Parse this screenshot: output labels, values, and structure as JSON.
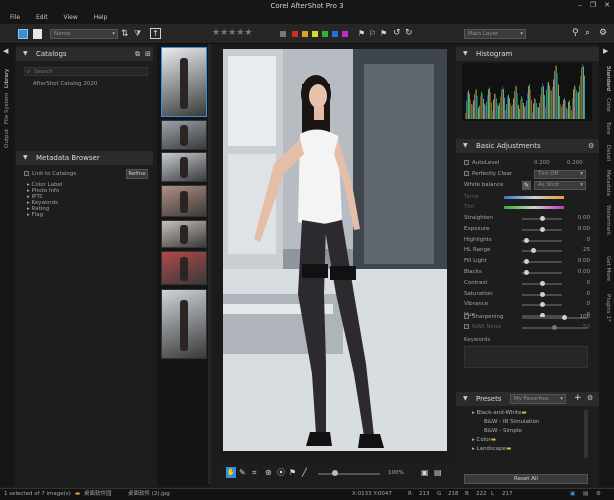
{
  "app": {
    "title": "Corel AfterShot Pro 3"
  },
  "menu": [
    "File",
    "Edit",
    "View",
    "Help"
  ],
  "window_controls": [
    "–",
    "❐",
    "✕"
  ],
  "toolbar": {
    "name_dropdown": "Name",
    "layer_dropdown": "Main Layer",
    "color_labels": [
      "#d12b2b",
      "#e0a020",
      "#d8d82a",
      "#2fb52f",
      "#2b6bd8",
      "#c22ac2"
    ]
  },
  "left_tabs": [
    "Library",
    "File System",
    "Output"
  ],
  "catalogs": {
    "title": "Catalogs",
    "search_placeholder": "Search",
    "items": [
      "AfterShot Catalog 2020"
    ]
  },
  "metadata": {
    "title": "Metadata Browser",
    "link_label": "Link to Catalogs",
    "refine_label": "Refine",
    "items": [
      "Color Label",
      "Photo Info",
      "IPTC",
      "Keywords",
      "Rating",
      "Flag"
    ]
  },
  "viewer": {
    "zoom": "100%"
  },
  "histogram": {
    "title": "Histogram"
  },
  "basic": {
    "title": "Basic Adjustments",
    "autolevel": {
      "label": "AutoLevel",
      "v1": "0.200",
      "v2": "0.200"
    },
    "perfectly_clear": {
      "label": "Perfectly Clear",
      "value": "Tint Off"
    },
    "white_balance": {
      "label": "White balance",
      "value": "As Shot"
    },
    "temp_label": "Temp",
    "tint_label": "Tint",
    "sliders": [
      {
        "label": "Straighten",
        "value": "0.00",
        "pos": 0.5
      },
      {
        "label": "Exposure",
        "value": "0.00",
        "pos": 0.5
      },
      {
        "label": "Highlights",
        "value": "0",
        "pos": 0.05
      },
      {
        "label": "HL Range",
        "value": "25",
        "pos": 0.25
      },
      {
        "label": "Fill Light",
        "value": "0.00",
        "pos": 0.05
      },
      {
        "label": "Blacks",
        "value": "0.00",
        "pos": 0.05
      },
      {
        "label": "Contrast",
        "value": "0",
        "pos": 0.5
      },
      {
        "label": "Saturation",
        "value": "0",
        "pos": 0.5
      },
      {
        "label": "Vibrance",
        "value": "0",
        "pos": 0.5
      },
      {
        "label": "Hue",
        "value": "0",
        "pos": 0.5
      }
    ],
    "sharpening": {
      "label": "Sharpening",
      "value": "100"
    },
    "raw_noise": {
      "label": "RAW Noise",
      "value": "50"
    },
    "keywords_label": "Keywords"
  },
  "presets": {
    "title": "Presets",
    "dropdown": "My Favorites",
    "items": [
      "Black-and-White",
      "B&W - IR Simulation",
      "B&W - Simple",
      "Color",
      "Landscape"
    ],
    "reset_label": "Reset All"
  },
  "right_tabs": [
    "Standard",
    "Color",
    "Tone",
    "Detail",
    "Metadata",
    "Watermark",
    "Get More",
    "Plugins 1*"
  ],
  "status": {
    "selection": "1 selected of 7 image(s)",
    "folder1": "桌面软件园",
    "folder2": "桌面软件 (2).jpg",
    "coords": "X:0133 Y:0047",
    "r_label": "R",
    "r": "213",
    "g_label": "G",
    "g": "218",
    "b_label": "B",
    "b": "222",
    "l_label": "L",
    "l": "217"
  }
}
